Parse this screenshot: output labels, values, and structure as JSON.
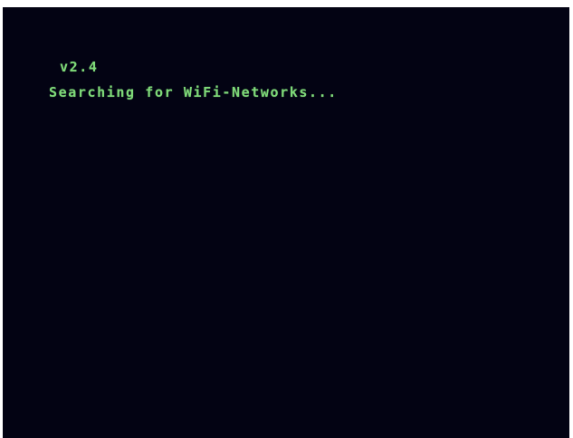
{
  "terminal": {
    "version": "v2.4",
    "status_message": "Searching for WiFi-Networks..."
  },
  "colors": {
    "background": "#030313",
    "text": "#7ed878",
    "frame": "#ffffff"
  }
}
